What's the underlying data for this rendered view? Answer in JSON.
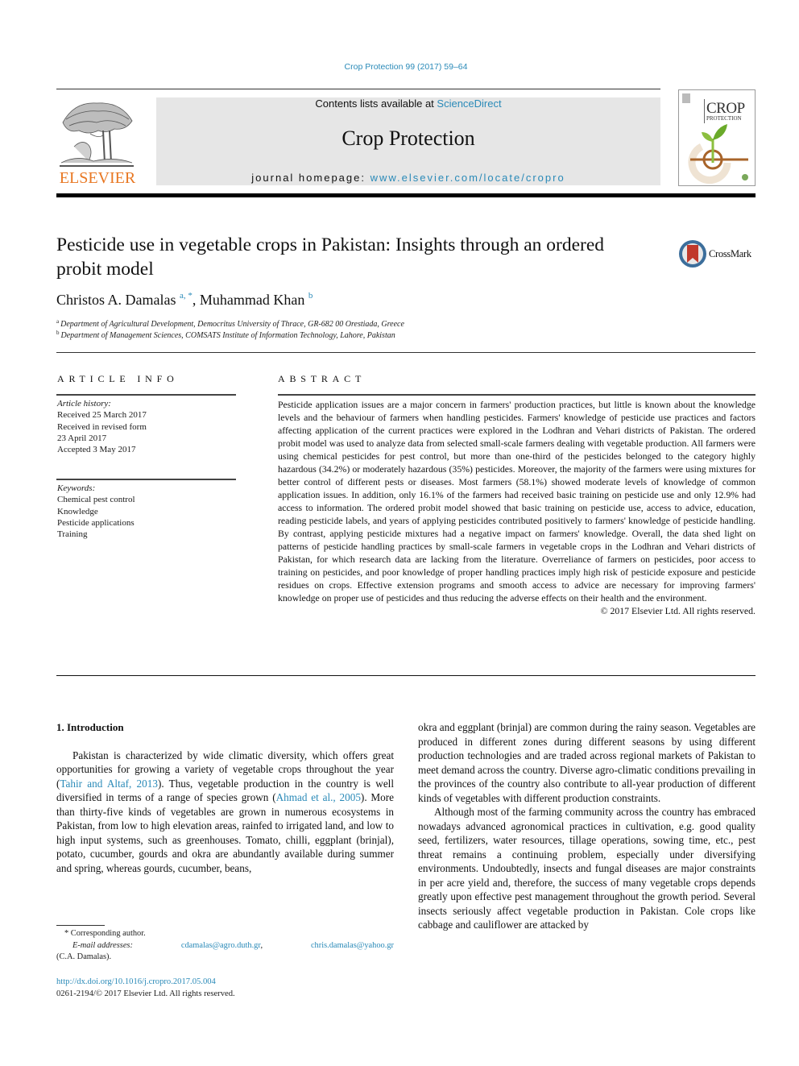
{
  "header": {
    "journal_ref": "Crop Protection 99 (2017) 59–64",
    "contents_prefix": "Contents lists available at ",
    "contents_link": "ScienceDirect",
    "journal_title": "Crop Protection",
    "homepage_prefix": "journal homepage: ",
    "homepage_link": "www.elsevier.com/locate/cropro",
    "publisher_logo_text": "ELSEVIER",
    "cover_title": "CROP",
    "cover_subtitle": "PROTECTION",
    "colors": {
      "link": "#2a8ab8",
      "elsevier_orange": "#e87722",
      "masthead_bg": "#e6e6e6"
    }
  },
  "article": {
    "title": "Pesticide use in vegetable crops in Pakistan: Insights through an ordered probit model",
    "crossmark_label": "CrossMark",
    "authors": [
      {
        "name": "Christos A. Damalas",
        "sup": "a, *"
      },
      {
        "name": "Muhammad Khan",
        "sup": "b"
      }
    ],
    "author_separator": ", ",
    "affiliations": [
      {
        "key": "a",
        "text": "Department of Agricultural Development, Democritus University of Thrace, GR-682 00 Orestiada, Greece"
      },
      {
        "key": "b",
        "text": "Department of Management Sciences, COMSATS Institute of Information Technology, Lahore, Pakistan"
      }
    ]
  },
  "article_info": {
    "heading": "ARTICLE INFO",
    "history_label": "Article history:",
    "history": [
      "Received 25 March 2017",
      "Received in revised form",
      "23 April 2017",
      "Accepted 3 May 2017"
    ],
    "keywords_label": "Keywords:",
    "keywords": [
      "Chemical pest control",
      "Knowledge",
      "Pesticide applications",
      "Training"
    ]
  },
  "abstract": {
    "heading": "ABSTRACT",
    "text": "Pesticide application issues are a major concern in farmers' production practices, but little is known about the knowledge levels and the behaviour of farmers when handling pesticides. Farmers' knowledge of pesticide use practices and factors affecting application of the current practices were explored in the Lodhran and Vehari districts of Pakistan. The ordered probit model was used to analyze data from selected small-scale farmers dealing with vegetable production. All farmers were using chemical pes­ticides for pest control, but more than one-third of the pesticides belonged to the category highly hazardous (34.2%) or moderately hazardous (35%) pesticides. Moreover, the majority of the farmers were using mixtures for better control of different pests or diseases. Most farmers (58.1%) showed moderate levels of knowledge of common application issues. In addition, only 16.1% of the farmers had received basic training on pesticide use and only 12.9% had access to information. The ordered probit model showed that basic training on pesticide use, access to advice, education, reading pesticide labels, and years of applying pesticides contributed positively to farmers' knowledge of pesticide handling. By contrast, applying pesticide mixtures had a negative impact on farmers' knowledge. Overall, the data shed light on patterns of pesticide handling practices by small-scale farmers in vegetable crops in the Lodhran and Vehari districts of Pakistan, for which research data are lacking from the literature. Over­reliance of farmers on pesticides, poor access to training on pesticides, and poor knowledge of proper handling practices imply high risk of pesticide exposure and pesticide residues on crops. Effective extension programs and smooth access to advice are necessary for improving farmers' knowledge on proper use of pesticides and thus reducing the adverse effects on their health and the environment.",
    "copyright": "© 2017 Elsevier Ltd. All rights reserved."
  },
  "body": {
    "section_title": "1.  Introduction",
    "p1_a": "Pakistan is characterized by wide climatic diversity, which offers great opportunities for growing a variety of vegetable crops throughout the year (",
    "p1_cite1": "Tahir and Altaf, 2013",
    "p1_b": "). Thus, vegetable pro­duction in the country is well diversified in terms of a range of species grown (",
    "p1_cite2": "Ahmad et al., 2005",
    "p1_c": "). More than thirty-five kinds of vegetables are grown in numerous ecosystems in Pakistan, from low to high elevation areas, rainfed to irrigated land, and low to high input systems, such as greenhouses. Tomato, chilli, eggplant (brinjal), potato, cucumber, gourds and okra are abundantly avail­able during summer and spring, whereas gourds, cucumber, beans,",
    "p1_cont": "okra and eggplant (brinjal) are common during the rainy season. Vegetables are produced in different zones during different seasons by using different production technologies and are traded across regional markets of Pakistan to meet demand across the country. Diverse agro-climatic conditions prevailing in the provinces of the country also contribute to all-year production of different kinds of vegetables with different production constraints.",
    "p2": "Although most of the farming community across the country has embraced nowadays advanced agronomical practices in culti­vation, e.g. good quality seed, fertilizers, water resources, tillage operations, sowing time, etc., pest threat remains a continuing problem, especially under diversifying environments. Undoubtedly, insects and fungal diseases are major constraints in per acre yield and, therefore, the success of many vegetable crops depends greatly upon effective pest management throughout the growth period. Several insects seriously affect vegetable production in Pakistan. Cole crops like cabbage and cauliflower are attacked by"
  },
  "footnote": {
    "corresponding": "* Corresponding author.",
    "email_label": "E-mail addresses:",
    "email1": "cdamalas@agro.duth.gr",
    "email_sep": ",",
    "email2": "chris.damalas@yahoo.gr",
    "email_owner": "(C.A. Damalas)."
  },
  "doi": {
    "link": "http://dx.doi.org/10.1016/j.cropro.2017.05.004",
    "issn_line": "0261-2194/© 2017 Elsevier Ltd. All rights reserved."
  }
}
